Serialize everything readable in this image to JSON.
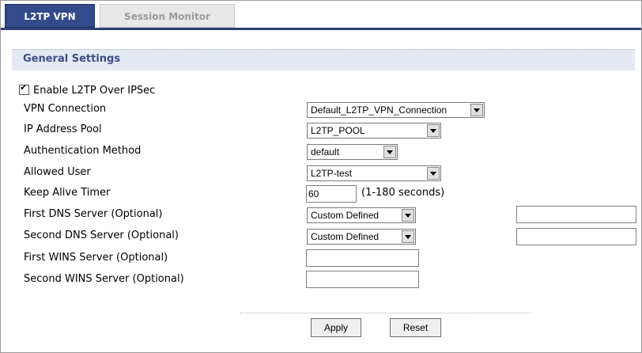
{
  "tabs": [
    {
      "label": "L2TP VPN",
      "active": true
    },
    {
      "label": "Session Monitor",
      "active": false
    }
  ],
  "section": {
    "title": "General Settings"
  },
  "enable": {
    "label": "Enable L2TP Over IPSec",
    "checked": true
  },
  "fields": {
    "vpn_connection": {
      "label": "VPN Connection",
      "value": "Default_L2TP_VPN_Connection"
    },
    "ip_pool": {
      "label": "IP Address Pool",
      "value": "L2TP_POOL"
    },
    "auth_method": {
      "label": "Authentication Method",
      "value": "default"
    },
    "allowed_user": {
      "label": "Allowed User",
      "value": "L2TP-test"
    },
    "keep_alive": {
      "label": "Keep Alive Timer",
      "value": "60",
      "hint": "(1-180 seconds)"
    },
    "first_dns": {
      "label": "First DNS Server (Optional)",
      "value": "Custom Defined",
      "custom_value": ""
    },
    "second_dns": {
      "label": "Second DNS Server (Optional)",
      "value": "Custom Defined",
      "custom_value": ""
    },
    "first_wins": {
      "label": "First WINS Server (Optional)",
      "value": ""
    },
    "second_wins": {
      "label": "Second WINS Server (Optional)",
      "value": ""
    }
  },
  "buttons": {
    "apply": "Apply",
    "reset": "Reset"
  },
  "colors": {
    "tab_active": "#334a8b",
    "section_bg": "#e4e9f4",
    "section_title": "#3a4f86"
  }
}
